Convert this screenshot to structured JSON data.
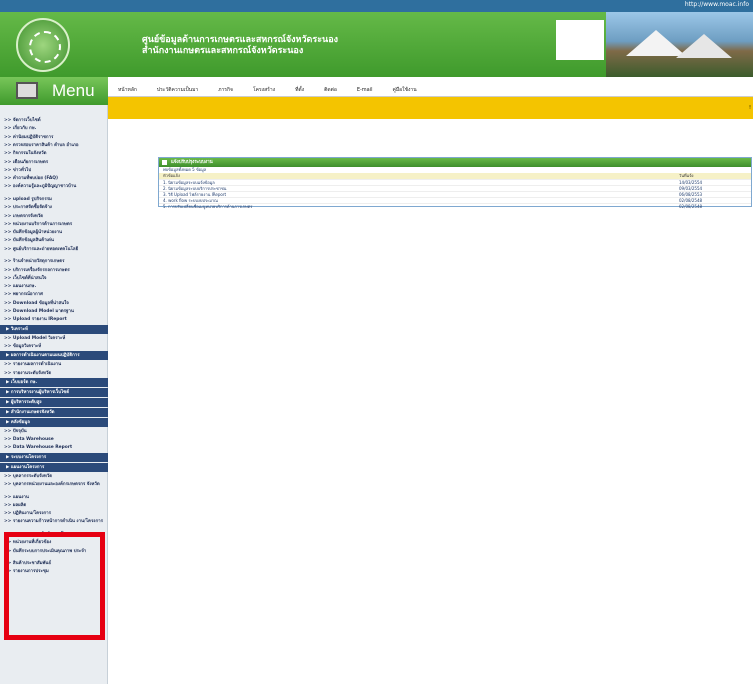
{
  "header": {
    "url_text": "http://www.moac.info",
    "title_line1": "ศูนย์ข้อมูลด้านการเกษตรและสหกรณ์จังหวัดระนอง",
    "title_line2": "สำนักงานเกษตรและสหกรณ์จังหวัดระนอง"
  },
  "menu_label": "Menu",
  "nav": [
    "หน้าหลัก",
    "ประวัติความเป็นมา",
    "ภารกิจ",
    "โครงสร้าง",
    "ที่ตั้ง",
    "ติดต่อ",
    "E-mail",
    "คู่มือใช้งาน"
  ],
  "sidebar": [
    {
      "type": "item",
      "text": ">> จัดการเว็บไซต์"
    },
    {
      "type": "item",
      "text": ">> เกี่ยวกับ กษ."
    },
    {
      "type": "item",
      "text": ">> ค่านิยมปฏิบัติราชการ"
    },
    {
      "type": "item",
      "text": ">> ตรวจสอบราคาสินค้า ตำบล อำเภอ"
    },
    {
      "type": "item",
      "text": ">> กิจกรรมในจังหวัด"
    },
    {
      "type": "item",
      "text": ">> เตือนภัยการเกษตร"
    },
    {
      "type": "item",
      "text": ">> ข่าวทั่วไป"
    },
    {
      "type": "item",
      "text": ">> คำถามที่พบบ่อย (FAQ)"
    },
    {
      "type": "item",
      "text": ">> องค์ความรู้และภูมิปัญญาชาวบ้าน"
    },
    {
      "type": "item",
      "text": ">> upload รูปกิจกรรม"
    },
    {
      "type": "item",
      "text": ">> ประกาศจัดซื้อจัดจ้าง"
    },
    {
      "type": "item",
      "text": ">> เกษตรกรจังหวัด"
    },
    {
      "type": "item",
      "text": ">> หน่วยงานบริการด้านการเกษตร"
    },
    {
      "type": "item",
      "text": ">> บันทึกข้อมูลผู้นำหน่วยงาน"
    },
    {
      "type": "item",
      "text": ">> บันทึกข้อมูลสินค้าเด่น"
    },
    {
      "type": "item",
      "text": ">> ศูนย์บริการและถ่ายทอดเทคโนโลยี"
    },
    {
      "type": "item",
      "text": ">> ร้านจำหน่ายวัสดุการเกษตร"
    },
    {
      "type": "item",
      "text": ">> บริการเครื่องจักรกลการเกษตร"
    },
    {
      "type": "item",
      "text": ">> เว็บไซต์ที่น่าสนใจ"
    },
    {
      "type": "item",
      "text": ">> แผนงานกษ."
    },
    {
      "type": "item",
      "text": ">> พยากรณ์อากาศ"
    },
    {
      "type": "item",
      "text": ">> Download ข้อมูลที่น่าสนใจ"
    },
    {
      "type": "item",
      "text": ">> Download Model มาตรฐาน"
    },
    {
      "type": "item",
      "text": ">> Upload รายงาน IReport"
    },
    {
      "type": "head",
      "text": "▶ วิเคราะห์"
    },
    {
      "type": "item",
      "text": ">> Upload Model วิเคราะห์"
    },
    {
      "type": "item",
      "text": ">> ข้อมูลวิเคราะห์"
    },
    {
      "type": "head",
      "text": "▶ ผลการดำเนินงานตามแผนปฏิบัติการ"
    },
    {
      "type": "item",
      "text": ">> รายงานผลการดำเนินงาน"
    },
    {
      "type": "item",
      "text": ">> รายงานระดับจังหวัด"
    },
    {
      "type": "head",
      "text": "▶ เว็บบอร์ด กษ."
    },
    {
      "type": "head",
      "text": "▶ การบริหารงานผู้บริหารเว็บไซต์"
    },
    {
      "type": "head",
      "text": "▶ ผู้บริหารระดับสูง"
    },
    {
      "type": "head",
      "text": "▶ สำนักงานเกษตรจังหวัด"
    },
    {
      "type": "head",
      "text": "▶ คลังข้อมูล"
    },
    {
      "type": "item",
      "text": ">> ปัจจุบัน"
    },
    {
      "type": "item",
      "text": ">> Data Warehouse"
    },
    {
      "type": "item",
      "text": ">> Data Warehouse Report"
    },
    {
      "type": "head",
      "text": "▶ ระบบงานโครงการ"
    },
    {
      "type": "head",
      "text": "▶ แผนงานโครงการ"
    },
    {
      "type": "item",
      "text": ">> บุคลากรระดับจังหวัด"
    },
    {
      "type": "item",
      "text": ">> บุคลากรหน่วยงานและองค์กรเกษตรกร จังหวัด"
    },
    {
      "type": "item",
      "text": ">> แผนงาน"
    },
    {
      "type": "item",
      "text": ">> ผลผลิต"
    },
    {
      "type": "item",
      "text": ">> ปฏิทินงาน/โครงการ"
    },
    {
      "type": "item",
      "text": ">> รายงานความก้าวหน้าการดำเนิน งาน/โครงการ"
    },
    {
      "type": "item",
      "text": ">> รายงานผลการดำเนินงานโครงการ"
    },
    {
      "type": "item",
      "text": ">> หน่วยงานที่เกี่ยวข้อง"
    },
    {
      "type": "item",
      "text": ">> บันทึกระบบการประเมินคุณภาพ ประจำ"
    },
    {
      "type": "item",
      "text": ">> สินค้าประชาสัมพันธ์"
    },
    {
      "type": "item",
      "text": ">> รายงานการประชุม"
    }
  ],
  "panel": {
    "title": "แจ้งปรับปรุงระบบงาน",
    "count_text": "พบข้อมูลทั้งหมด 5 ข้อมูล",
    "col_title": "หัวข้อแจ้ง",
    "col_date": "วันที่แจ้ง",
    "rows": [
      {
        "title": "1. นิยามข้อมูลระบบแจ้งข้อมูล",
        "date": "14/03/2554"
      },
      {
        "title": "2. นิยามข้อมูลระบบบริการประชาชน",
        "date": "09/03/2554"
      },
      {
        "title": "3. วิธี Upload ไฟล์รายงาน IReport",
        "date": "06/08/2553"
      },
      {
        "title": "4. work flow ระบบงบประมาณ",
        "date": "02/08/2548"
      },
      {
        "title": "5. การปรับเปลี่ยนชื่อเมนูหน่วยบริการด้านการเกษตร",
        "date": "02/08/2548"
      }
    ]
  },
  "colors": {
    "accent_green": "#3f9a2c",
    "nav_yellow": "#f4c400",
    "sidebar_head": "#2b4a7a",
    "highlight": "#e60012"
  }
}
